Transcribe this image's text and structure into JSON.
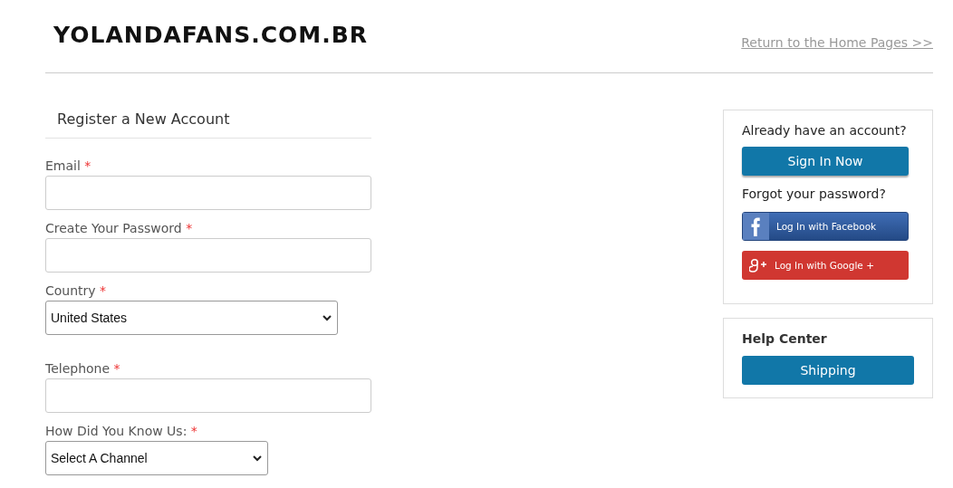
{
  "header": {
    "logo": "YOLANDAFANS.COM.BR",
    "home_link": "Return to the Home Pages >>"
  },
  "register": {
    "title": "Register a New Account",
    "fields": [
      {
        "kind": "input",
        "label": "Email",
        "required_mark": "*"
      },
      {
        "kind": "input",
        "label": "Create Your Password",
        "required_mark": "*"
      },
      {
        "kind": "select",
        "label": "Country",
        "required_mark": "*",
        "value": "United States"
      },
      {
        "kind": "input",
        "label": "Telephone",
        "required_mark": "*"
      },
      {
        "kind": "select",
        "label": "How Did You Know Us:",
        "required_mark": "*",
        "value": "Select A Channel"
      }
    ]
  },
  "login_box": {
    "prompt": "Already have an account?",
    "sign_in": "Sign In Now",
    "forgot": "Forgot your password?",
    "social": [
      {
        "kind": "facebook",
        "label": "Log In with Facebook"
      },
      {
        "kind": "google",
        "label": "Log In with Google +"
      }
    ]
  },
  "help_box": {
    "title": "Help Center",
    "buttons": [
      "Shipping"
    ]
  }
}
